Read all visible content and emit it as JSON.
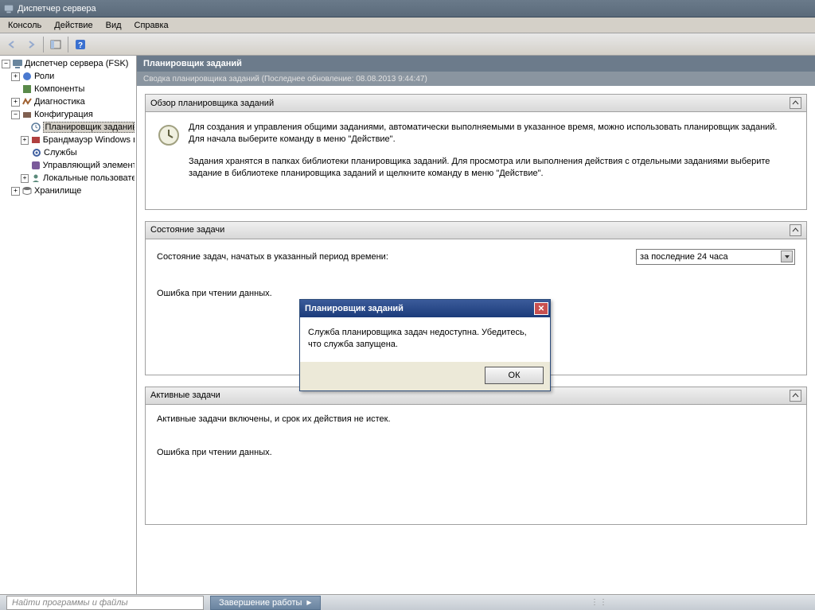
{
  "window": {
    "title": "Диспетчер сервера"
  },
  "menu": {
    "items": [
      "Консоль",
      "Действие",
      "Вид",
      "Справка"
    ]
  },
  "tree": {
    "root": "Диспетчер сервера (FSK)",
    "n_roles": "Роли",
    "n_comp": "Компоненты",
    "n_diag": "Диагностика",
    "n_conf": "Конфигурация",
    "n_sched": "Планировщик заданий",
    "n_fire": "Брандмауэр Windows в ре",
    "n_svc": "Службы",
    "n_wmi": "Управляющий элемент W",
    "n_users": "Локальные пользователи",
    "n_stor": "Хранилище"
  },
  "content": {
    "title": "Планировщик заданий",
    "subtitle": "Сводка планировщика заданий (Последнее обновление: 08.08.2013 9:44:47)"
  },
  "overview": {
    "header": "Обзор планировщика заданий",
    "p1": "Для создания и управления общими заданиями, автоматически выполняемыми в указанное время, можно использовать планировщик заданий. Для начала выберите команду в меню \"Действие\".",
    "p2": "Задания хранятся в папках библиотеки планировщика заданий. Для просмотра или выполнения действия с отдельными заданиями выберите задание в библиотеке планировщика заданий и щелкните команду в меню \"Действие\"."
  },
  "status": {
    "header": "Состояние задачи",
    "label": "Состояние задач, начатых в указанный период времени:",
    "dropdown": "за последние 24 часа",
    "error": "Ошибка при чтении данных."
  },
  "active": {
    "header": "Активные задачи",
    "desc": "Активные задачи включены, и срок их действия не истек.",
    "error": "Ошибка при чтении данных."
  },
  "modal": {
    "title": "Планировщик заданий",
    "body": "Служба планировщика задач недоступна. Убедитесь, что служба запущена.",
    "ok": "ОК"
  },
  "taskbar": {
    "search_placeholder": "Найти программы и файлы",
    "task": "Завершение работы"
  }
}
